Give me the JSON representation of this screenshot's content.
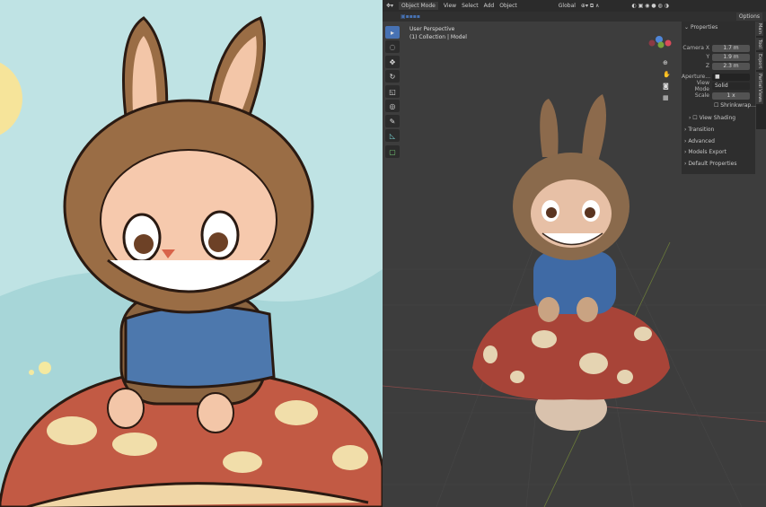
{
  "header": {
    "mode": "Object Mode",
    "menus": [
      "View",
      "Select",
      "Add",
      "Object"
    ],
    "orientation": "Global",
    "options": "Options"
  },
  "viewport": {
    "info_line1": "User Perspective",
    "info_line2": "(1) Collection | Model"
  },
  "tools": [
    "select-box",
    "cursor",
    "move",
    "rotate",
    "scale",
    "transform",
    "annotate",
    "measure",
    "add-cube"
  ],
  "npanel": {
    "title": "Properties",
    "rows": [
      {
        "label": "Camera X",
        "value": "1.7 m"
      },
      {
        "label": "Y",
        "value": "1.9 m"
      },
      {
        "label": "Z",
        "value": "2.3 m"
      }
    ],
    "aperture_label": "Aperture...",
    "view_mode_label": "View Mode",
    "view_mode_value": "Solid",
    "scale_label": "Scale",
    "scale_value": "1 x",
    "shrinkwrap_label": "Shrinkwrap...",
    "view_shading": "View Shading",
    "sections": [
      "Transition",
      "Advanced",
      "Models Export",
      "Default Properties"
    ]
  },
  "side_tabs": [
    "Main",
    "Tool",
    "Export",
    "Partial Views"
  ],
  "colors": {
    "accent": "#4772b3",
    "viewport_bg": "#3d3d3d"
  }
}
